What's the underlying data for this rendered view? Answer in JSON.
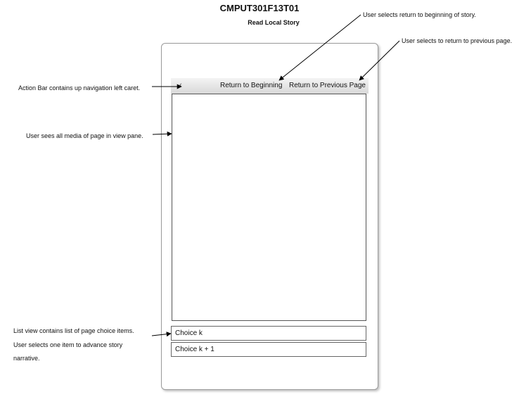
{
  "title": "CMPUT301F13T01",
  "subtitle": "Read Local Story",
  "action_bar": {
    "return_beginning": "Return to Beginning",
    "return_previous": "Return to Previous Page"
  },
  "choices": [
    "Choice k",
    "Choice k + 1"
  ],
  "annotations": {
    "return_beginning": "User selects return to beginning of story.",
    "return_previous": "User selects to return to previous page.",
    "action_bar": "Action Bar contains up navigation left caret.",
    "view_pane": "User sees all  media of page in view pane.",
    "list_view_line1": "List view contains list of page choice items.",
    "list_view_line2": "User selects one item  to advance story",
    "list_view_line3": "narrative."
  }
}
